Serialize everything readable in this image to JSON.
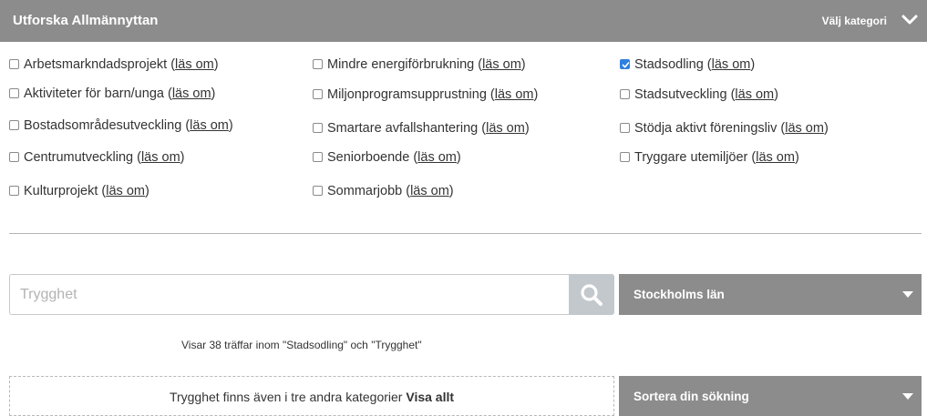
{
  "header": {
    "title": "Utforska Allmännyttan",
    "category_label": "Välj kategori"
  },
  "categories": {
    "link_label": "läs om",
    "items": [
      {
        "label": "Arbetsmarkndadsprojekt",
        "checked": false
      },
      {
        "label": "Aktiviteter för barn/unga",
        "checked": false
      },
      {
        "label": "Bostadsområdesutveckling",
        "checked": false
      },
      {
        "label": "Centrumutveckling",
        "checked": false
      },
      {
        "label": "Kulturprojekt",
        "checked": false
      },
      {
        "label": "Mindre energiförbrukning",
        "checked": false
      },
      {
        "label": "Miljonprogramsupprustning",
        "checked": false
      },
      {
        "label": "Smartare avfallshantering",
        "checked": false
      },
      {
        "label": "Seniorboende",
        "checked": false
      },
      {
        "label": "Sommarjobb",
        "checked": false
      },
      {
        "label": "Stadsodling",
        "checked": true
      },
      {
        "label": "Stadsutveckling",
        "checked": false
      },
      {
        "label": "Stödja aktivt föreningsliv",
        "checked": false
      },
      {
        "label": "Tryggare utemiljöer",
        "checked": false
      }
    ]
  },
  "search": {
    "value": "",
    "placeholder": "Trygghet"
  },
  "region": {
    "selected": "Stockholms län"
  },
  "results": {
    "summary": "Visar 38 träffar inom \"Stadsodling\" och \"Trygghet\""
  },
  "also": {
    "text": "Trygghet finns även i tre andra kategorier",
    "link": "Visa allt"
  },
  "sort": {
    "label": "Sortera din sökning"
  },
  "colors": {
    "header_bg": "#8c8c8c",
    "checkbox_checked": "#2f7fe0",
    "search_button": "#c3c8cd"
  }
}
